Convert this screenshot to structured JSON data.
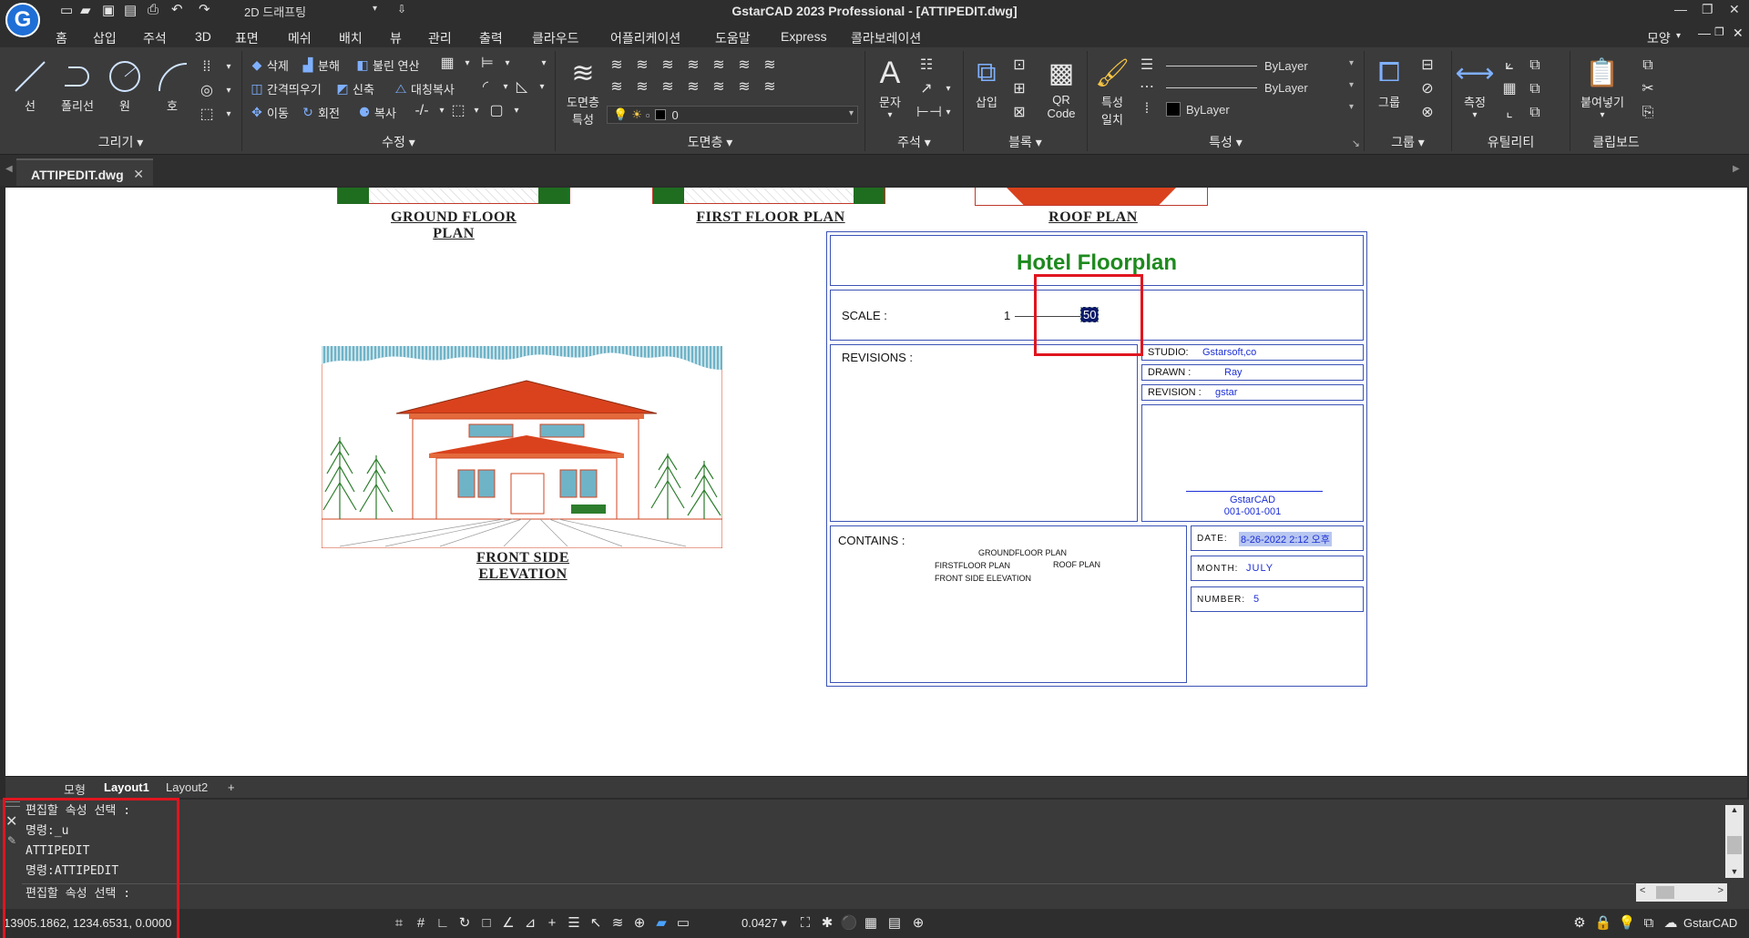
{
  "app": {
    "title": "GstarCAD 2023 Professional - [ATTIPEDIT.dwg]",
    "logo_letter": "G",
    "workspace": "2D 드래프팅",
    "view_label": "모양"
  },
  "menus": [
    "홈",
    "삽입",
    "주석",
    "3D",
    "표면",
    "메쉬",
    "배치",
    "뷰",
    "관리",
    "출력",
    "클라우드",
    "어플리케이션",
    "도움말",
    "Express",
    "콜라보레이션"
  ],
  "ribbon": {
    "draw": {
      "label": "그리기",
      "tools": [
        "선",
        "폴리선",
        "원",
        "호"
      ]
    },
    "modify": {
      "label": "수정",
      "rows": [
        [
          "삭제",
          "분해",
          "불린 연산"
        ],
        [
          "간격띄우기",
          "신축",
          "대칭복사"
        ],
        [
          "이동",
          "회전",
          "복사"
        ]
      ]
    },
    "layers": {
      "label": "도면층",
      "tool": "도면층\n특성",
      "tool_line1": "도면층",
      "tool_line2": "특성",
      "current_layer": "0"
    },
    "annotation": {
      "label": "주석",
      "tool": "문자"
    },
    "block": {
      "label": "블록",
      "tools": [
        "삽입",
        "QR Code"
      ],
      "qr_line1": "QR",
      "qr_line2": "Code"
    },
    "properties": {
      "label": "특성",
      "match": "특성\n일치",
      "match_line1": "특성",
      "match_line2": "일치",
      "linetype": "ByLayer",
      "lineweight": "ByLayer",
      "color": "ByLayer"
    },
    "group": {
      "label": "그룹",
      "tool": "그룹"
    },
    "utilities": {
      "label": "유틸리티",
      "tool": "측정"
    },
    "clipboard": {
      "label": "클립보드",
      "tool": "붙여넣기"
    }
  },
  "doc_tab": {
    "name": "ATTIPEDIT.dwg"
  },
  "drawing": {
    "ground_floor": "GROUND FLOOR\nPLAN",
    "ground_floor_l1": "GROUND FLOOR",
    "ground_floor_l2": "PLAN",
    "first_floor": "FIRST FLOOR PLAN",
    "roof_plan": "ROOF PLAN",
    "front_side_l1": "FRONT SIDE",
    "front_side_l2": "ELEVATION",
    "title_block": {
      "title": "Hotel Floorplan",
      "scale_label": "SCALE :",
      "scale_num": "1",
      "scale_den": "50",
      "revisions_label": "REVISIONS :",
      "studio_label": "STUDIO:",
      "studio": "Gstarsoft,co",
      "drawn_label": "DRAWN :",
      "drawn": "Ray",
      "revision_label": "REVISION :",
      "revision": "gstar",
      "company": "GstarCAD",
      "sheet_no": "001-001-001",
      "contains_label": "CONTAINS :",
      "contains_1": "GROUNDFLOOR PLAN",
      "contains_2": "FIRSTFLOOR PLAN",
      "contains_3": "ROOF PLAN",
      "contains_4": "FRONT SIDE ELEVATION",
      "date_label": "DATE:",
      "date": "8-26-2022 2:12 오후",
      "month_label": "MONTH:",
      "month": "JULY",
      "number_label": "NUMBER:",
      "number": "5"
    }
  },
  "layout_tabs": [
    "모형",
    "Layout1",
    "Layout2",
    "+"
  ],
  "command_history": [
    "편집할 속성 선택 :",
    "명령:_u",
    "ATTIPEDIT",
    "명령:ATTIPEDIT"
  ],
  "command_prompt": "편집할 속성 선택 :",
  "status": {
    "coords": "13905.1862, 1234.6531, 0.0000",
    "scale_value": "0.0427",
    "brand": "GstarCAD"
  },
  "colors": {
    "title_green": "#1e8a1e",
    "block_blue": "#1c2fd6",
    "highlight_red": "#e0151f"
  }
}
